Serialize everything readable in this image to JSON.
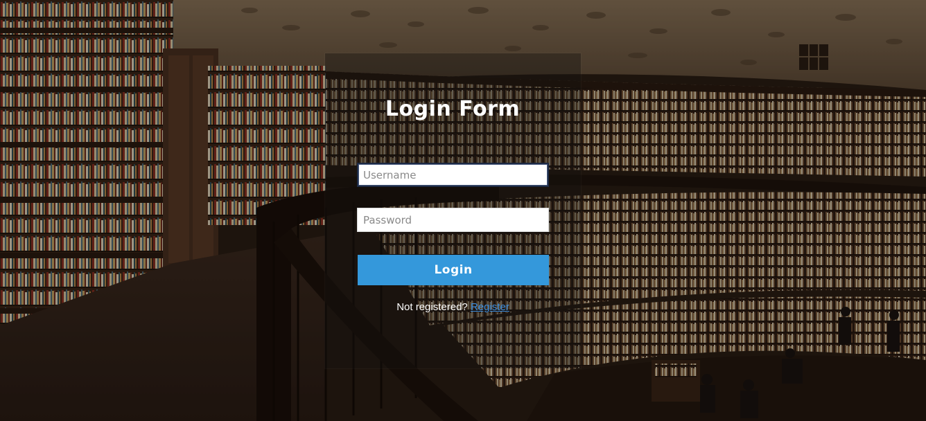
{
  "form": {
    "title": "Login Form",
    "username_placeholder": "Username",
    "password_placeholder": "Password",
    "login_label": "Login",
    "register_prompt": "Not registered?",
    "register_link": "Register"
  },
  "colors": {
    "accent": "#3498db",
    "link": "#3d8fe0",
    "title": "#ffffff"
  }
}
